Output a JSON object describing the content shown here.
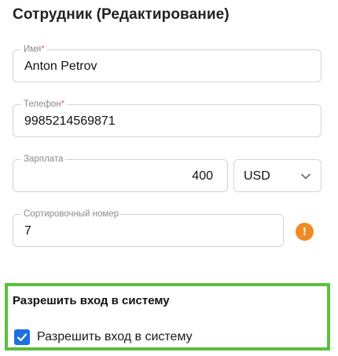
{
  "page": {
    "title": "Сотрудник (Редактирование)"
  },
  "form": {
    "name": {
      "label": "Имя",
      "required_mark": "*",
      "value": "Anton Petrov"
    },
    "phone": {
      "label": "Телефон",
      "required_mark": "*",
      "value": "9985214569871"
    },
    "salary": {
      "label": "Зарплата",
      "value": "400"
    },
    "currency": {
      "value": "USD",
      "icon": "chevron-down-icon"
    },
    "sort_number": {
      "label": "Сортировочный номер",
      "value": "7"
    },
    "warning": {
      "icon": "exclamation-icon",
      "glyph": "!",
      "color": "#f08a24"
    }
  },
  "login_section": {
    "title": "Разрешить вход в систему",
    "checkbox_label": "Разрешить вход в систему",
    "checked": true,
    "highlight_color": "#5bbf3d",
    "checkbox_color": "#1f6fe0"
  }
}
